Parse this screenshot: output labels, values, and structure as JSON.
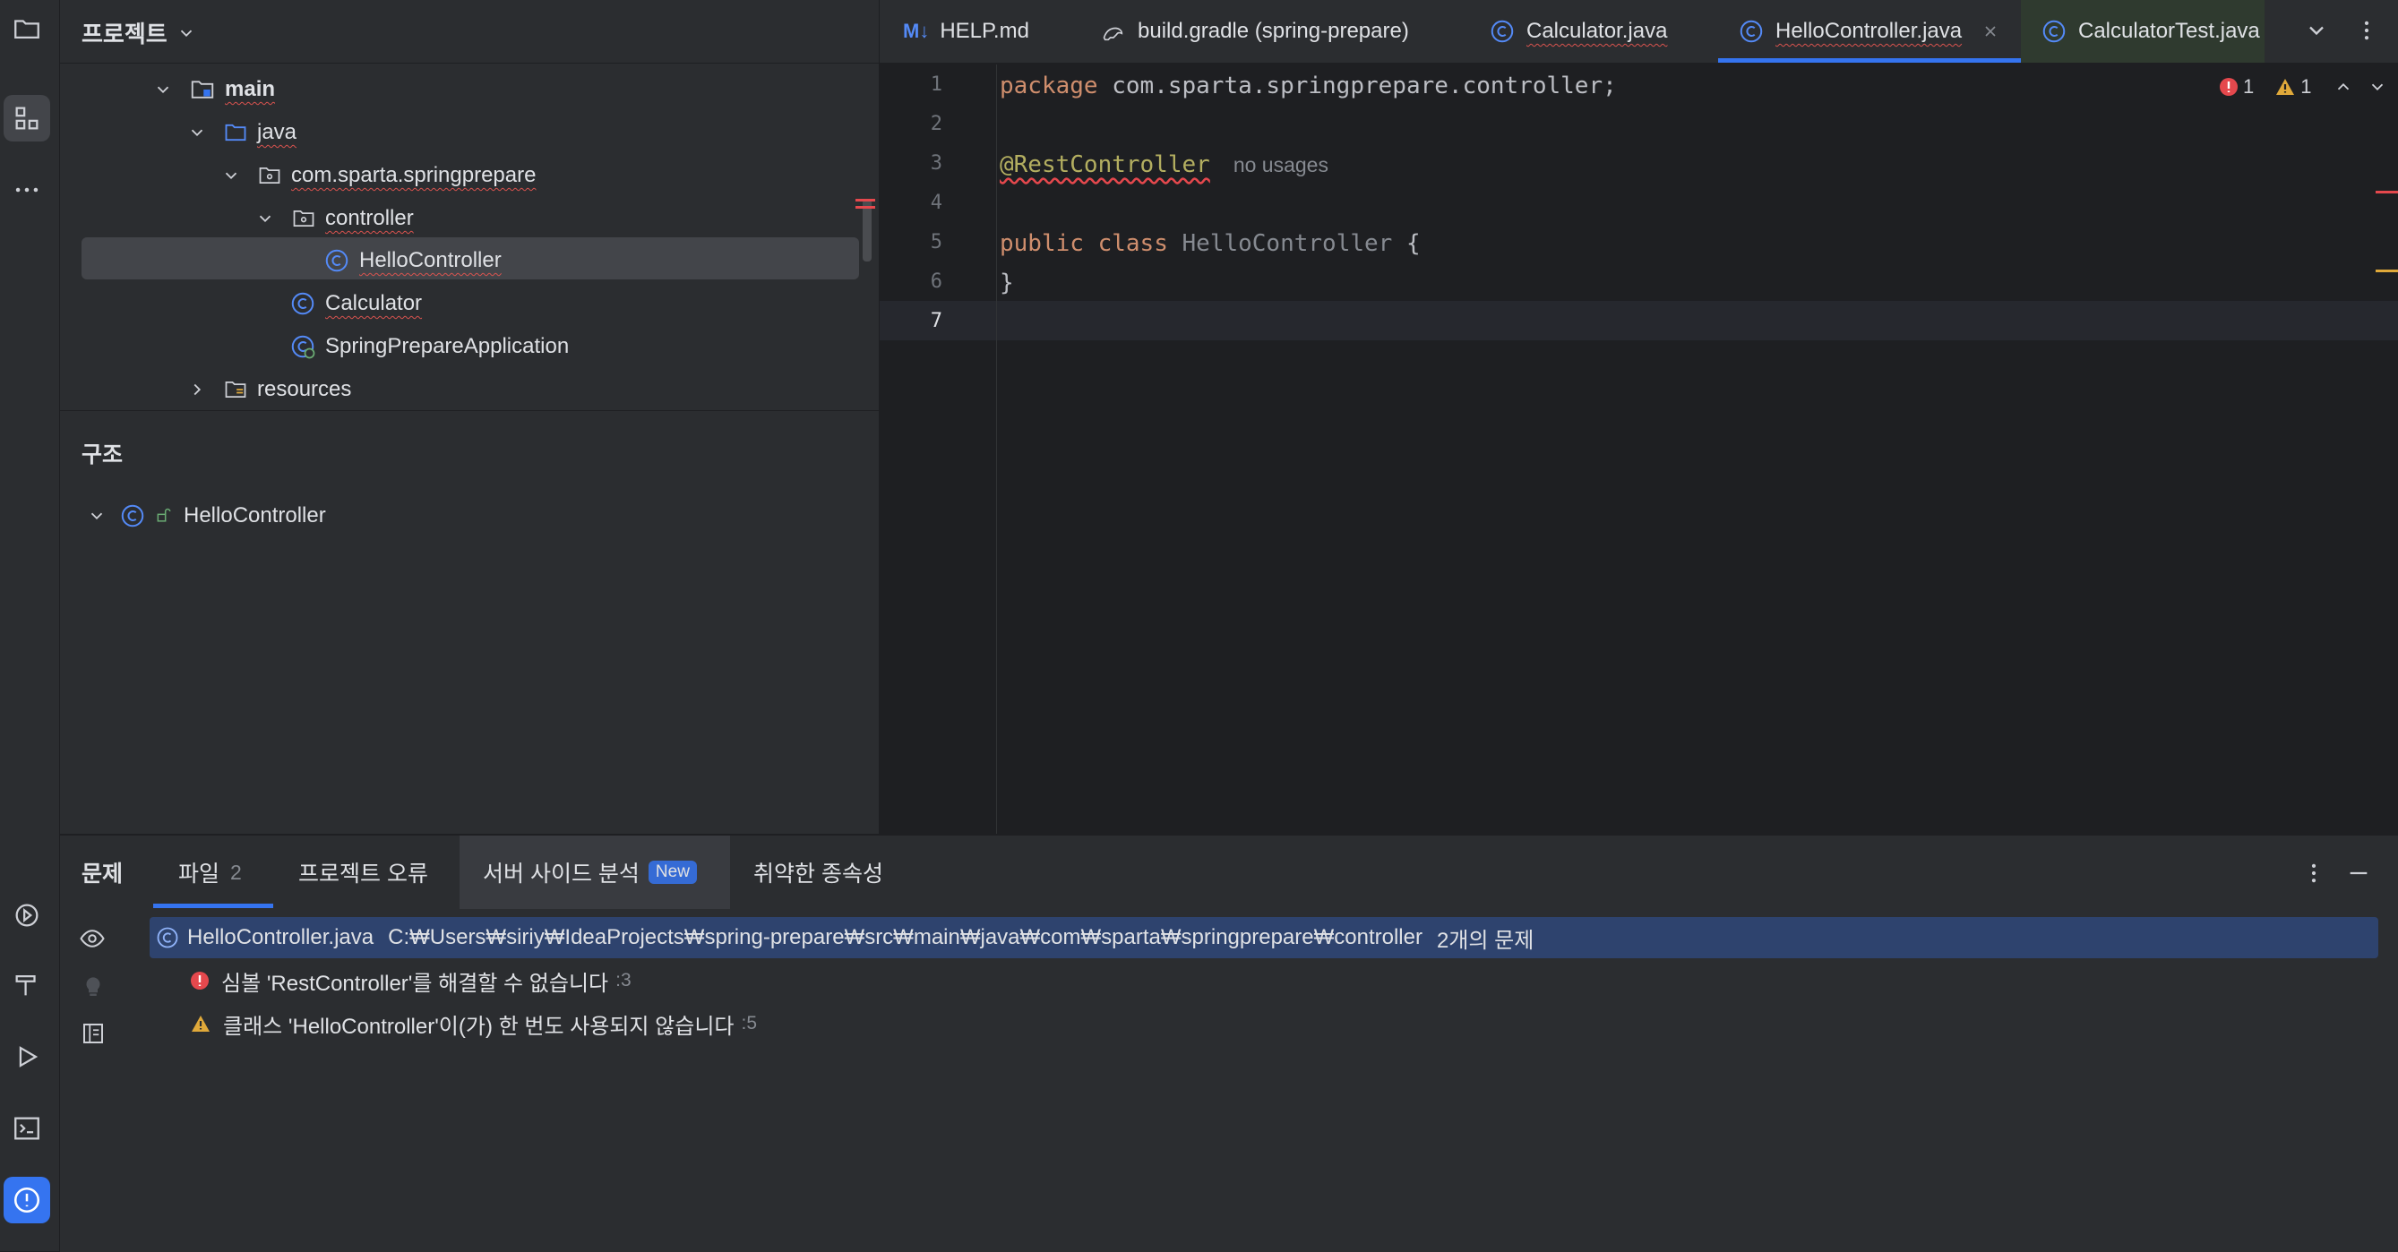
{
  "project_panel": {
    "title": "프로젝트",
    "tree": [
      {
        "label": "main"
      },
      {
        "label": "java"
      },
      {
        "label": "com.sparta.springprepare"
      },
      {
        "label": "controller"
      },
      {
        "label": "HelloController"
      },
      {
        "label": "Calculator"
      },
      {
        "label": "SpringPrepareApplication"
      },
      {
        "label": "resources"
      }
    ]
  },
  "structure_panel": {
    "title": "구조",
    "items": [
      {
        "label": "HelloController"
      }
    ]
  },
  "editor": {
    "tabs": [
      {
        "label": "HELP.md",
        "icon": "markdown-icon"
      },
      {
        "label": "build.gradle (spring-prepare)",
        "icon": "gradle-icon"
      },
      {
        "label": "Calculator.java",
        "icon": "class-icon"
      },
      {
        "label": "HelloController.java",
        "icon": "class-icon",
        "active": true
      },
      {
        "label": "CalculatorTest.java",
        "icon": "class-icon"
      }
    ],
    "line_numbers": [
      "1",
      "2",
      "3",
      "4",
      "5",
      "6",
      "7"
    ],
    "code": {
      "line1_kw": "package",
      "line1_rest": " com.sparta.springprepare.controller;",
      "line3_ann": "@RestController",
      "line3_hint": "no usages",
      "line5_kw1": "public",
      "line5_kw2": "class",
      "line5_name": "HelloController",
      "line5_brace": " {",
      "line6": "}"
    },
    "inspection": {
      "errors": "1",
      "warnings": "1"
    }
  },
  "problems_panel": {
    "tabs": [
      {
        "label": "문제"
      },
      {
        "label": "파일",
        "count": "2"
      },
      {
        "label": "프로젝트 오류"
      },
      {
        "label": "서버 사이드 분석",
        "badge": "New"
      },
      {
        "label": "취약한 종속성"
      }
    ],
    "file_row": {
      "file": "HelloController.java",
      "path": "C:₩Users₩siriy₩IdeaProjects₩spring-prepare₩src₩main₩java₩com₩sparta₩springprepare₩controller",
      "summary": "2개의 문제"
    },
    "problems": [
      {
        "severity": "error",
        "text": "심볼 'RestController'를 해결할 수 없습니다",
        "line": ":3"
      },
      {
        "severity": "warning",
        "text": "클래스 'HelloController'이(가) 한 번도 사용되지 않습니다",
        "line": ":5"
      }
    ]
  },
  "colors": {
    "accent": "#3574f0",
    "error": "#e5484d",
    "warning": "#e0a93a",
    "keyword": "#cf8e6d",
    "annotation": "#b3ae60"
  }
}
